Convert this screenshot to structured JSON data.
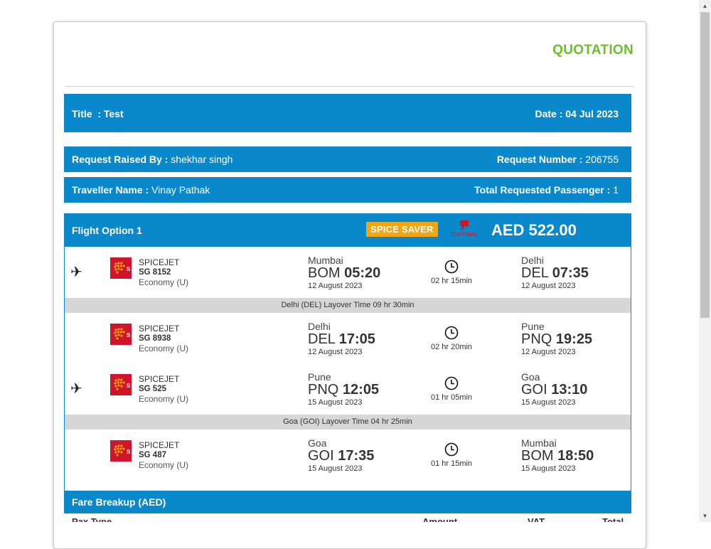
{
  "header": {
    "quotation": "QUOTATION"
  },
  "info": {
    "title_label": "Title",
    "title_value": ": Test",
    "date_label": "Date",
    "date_value": ": 04 Jul 2023",
    "raised_by_label": "Request Raised By :",
    "raised_by_value": "shekhar singh",
    "request_number_label": "Request Number :",
    "request_number_value": "206755",
    "traveller_label": "Traveller Name :",
    "traveller_value": "Vinay Pathak",
    "passengers_label": "Total Requested Passenger :",
    "passengers_value": "1"
  },
  "flight_option": {
    "label": "Flight Option 1",
    "fare_type": "SPICE SAVER",
    "policy_label": "Out Policy",
    "price": "AED 522.00"
  },
  "segments": [
    {
      "airline": "SPICEJET",
      "flight": "SG 8152",
      "class": "Economy (U)",
      "from_city": "Mumbai",
      "from_code": "BOM",
      "from_time": "05:20",
      "from_date": "12 August 2023",
      "duration": "02 hr 15min",
      "to_city": "Delhi",
      "to_code": "DEL",
      "to_time": "07:35",
      "to_date": "12 August 2023"
    },
    {
      "airline": "SPICEJET",
      "flight": "SG 8938",
      "class": "Economy (U)",
      "from_city": "Delhi",
      "from_code": "DEL",
      "from_time": "17:05",
      "from_date": "12 August 2023",
      "duration": "02 hr 20min",
      "to_city": "Pune",
      "to_code": "PNQ",
      "to_time": "19:25",
      "to_date": "12 August 2023"
    },
    {
      "airline": "SPICEJET",
      "flight": "SG 525",
      "class": "Economy (U)",
      "from_city": "Pune",
      "from_code": "PNQ",
      "from_time": "12:05",
      "from_date": "15 August 2023",
      "duration": "01 hr 05min",
      "to_city": "Goa",
      "to_code": "GOI",
      "to_time": "13:10",
      "to_date": "15 August 2023"
    },
    {
      "airline": "SPICEJET",
      "flight": "SG 487",
      "class": "Economy (U)",
      "from_city": "Goa",
      "from_code": "GOI",
      "from_time": "17:35",
      "from_date": "15 August 2023",
      "duration": "01 hr 15min",
      "to_city": "Mumbai",
      "to_code": "BOM",
      "to_time": "18:50",
      "to_date": "15 August 2023"
    }
  ],
  "layovers": [
    "Delhi (DEL) Layover Time 09 hr 30min",
    "Goa (GOI) Layover Time 04 hr 25min"
  ],
  "fare_breakup": {
    "title": "Fare Breakup (AED)",
    "columns": [
      "Pax Type",
      "Amount",
      "VAT",
      "Total"
    ]
  },
  "colors": {
    "accent": "#0a88cc",
    "quotation": "#6cbf2a",
    "badge": "#f3a60e",
    "layover_bg": "#d6d6d6"
  },
  "icons": {
    "plane": "airplane-icon",
    "clock": "clock-icon",
    "policy": "thumbs-down-icon",
    "logo": "spicejet-logo"
  }
}
